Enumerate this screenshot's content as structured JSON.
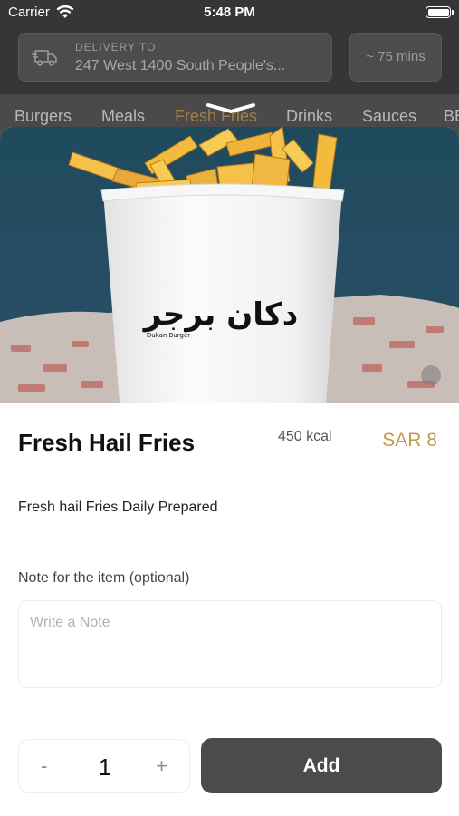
{
  "status_bar": {
    "carrier": "Carrier",
    "time": "5:48 PM"
  },
  "header": {
    "delivery_caption": "DELIVERY TO",
    "delivery_address": "247 West 1400 South People's...",
    "eta": "~ 75 mins"
  },
  "categories": [
    {
      "label": "Burgers",
      "active": false
    },
    {
      "label": "Meals",
      "active": false
    },
    {
      "label": "Fresh Fries",
      "active": true
    },
    {
      "label": "Drinks",
      "active": false
    },
    {
      "label": "Sauces",
      "active": false
    },
    {
      "label": "BE",
      "active": false
    }
  ],
  "product_image": {
    "cup_text_arabic": "دكان برجر",
    "cup_text_latin": "Dukan Burger"
  },
  "item": {
    "title": "Fresh Hail Fries",
    "calories": "450 kcal",
    "price": "SAR 8",
    "description": "Fresh hail Fries Daily Prepared"
  },
  "note": {
    "label": "Note for the item (optional)",
    "placeholder": "Write a Note",
    "value": ""
  },
  "quantity": {
    "minus_label": "-",
    "value": "1",
    "plus_label": "+"
  },
  "actions": {
    "add_label": "Add"
  },
  "colors": {
    "accent": "#c29a4e",
    "active_tab": "#a58047",
    "primary_button": "#4b4b4b"
  },
  "icons": [
    "wifi-icon",
    "battery-icon",
    "delivery-truck-icon",
    "chevron-down-icon"
  ]
}
